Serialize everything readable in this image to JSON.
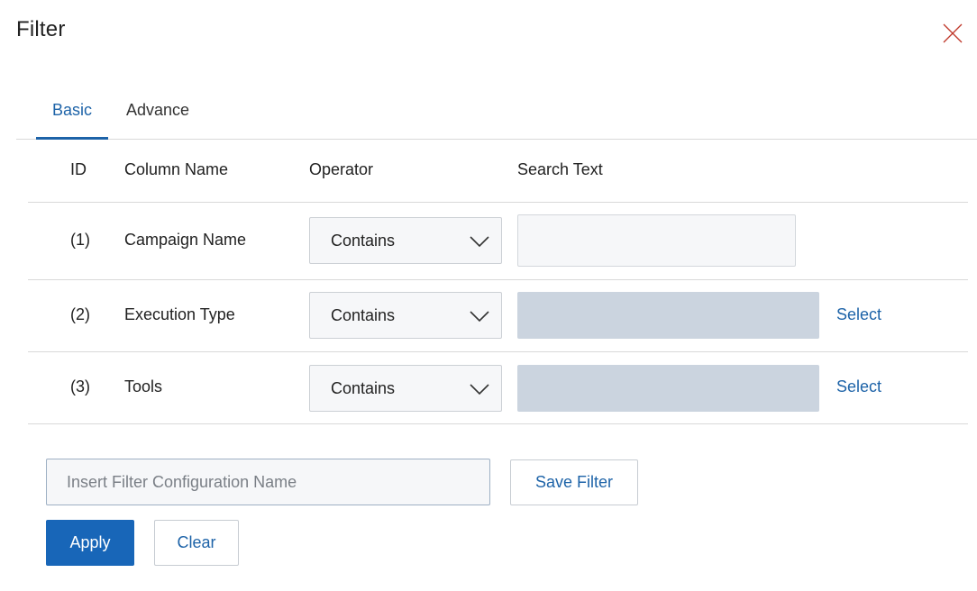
{
  "dialog": {
    "title": "Filter",
    "close_icon": "close-icon"
  },
  "tabs": [
    {
      "label": "Basic",
      "active": true
    },
    {
      "label": "Advance",
      "active": false
    }
  ],
  "table": {
    "headers": {
      "id": "ID",
      "column_name": "Column Name",
      "operator": "Operator",
      "search_text": "Search Text"
    },
    "rows": [
      {
        "id": "(1)",
        "column_name": "Campaign Name",
        "operator": "Contains",
        "search_value": "",
        "search_enabled": true,
        "select_label": ""
      },
      {
        "id": "(2)",
        "column_name": "Execution Type",
        "operator": "Contains",
        "search_value": "",
        "search_enabled": false,
        "select_label": "Select"
      },
      {
        "id": "(3)",
        "column_name": "Tools",
        "operator": "Contains",
        "search_value": "",
        "search_enabled": false,
        "select_label": "Select"
      }
    ]
  },
  "config": {
    "placeholder": "Insert Filter Configuration Name",
    "save_label": "Save Filter"
  },
  "actions": {
    "apply_label": "Apply",
    "clear_label": "Clear"
  },
  "colors": {
    "accent": "#1d63a8",
    "primary_button": "#1866b8",
    "close_icon": "#c0392b",
    "disabled_field": "#cbd4df"
  }
}
